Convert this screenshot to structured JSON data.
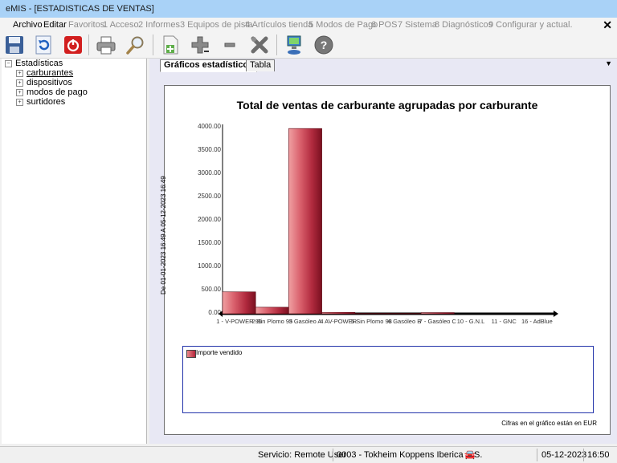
{
  "window": {
    "title": "eMIS - [ESTADISTICAS DE VENTAS]"
  },
  "menu": {
    "items": [
      "Archivo",
      "Editar",
      "Favoritos",
      "1 Acceso",
      "2 Informes",
      "3 Equipos de pista",
      "4 Artículos tienda",
      "5 Modos de Pago",
      "6 POS",
      "7 Sistema",
      "8 Diagnósticos",
      "9 Configurar y actual."
    ],
    "close": "✕"
  },
  "toolbar": {
    "icons": [
      "save-icon",
      "undo-icon",
      "power-icon",
      "print-icon",
      "search-icon",
      "new-document-icon",
      "add-icon",
      "remove-icon",
      "tools-icon",
      "network-computer-icon",
      "help-icon"
    ]
  },
  "tree": {
    "root": "Estadísticas",
    "items": [
      "carburantes",
      "dispositivos",
      "modos de pago",
      "surtidores"
    ]
  },
  "tabs": [
    "Gráficos estadísticos",
    "Tabla"
  ],
  "chart_data": {
    "type": "bar",
    "title": "Total de ventas de carburante agrupadas por carburante",
    "categories": [
      "1 - V-POWER 95",
      "2 - Sin Plomo 95",
      "3 - Gasóleo A",
      "4 - AV-POWER",
      "5 - Sin Plomo 98",
      "6 - Gasóleo B",
      "7 - Gasóleo C",
      "10 - G.N.L",
      "11 - GNC",
      "16 - AdBlue"
    ],
    "series": [
      {
        "name": "Importe vendido",
        "values": [
          470,
          140,
          3980,
          30,
          8,
          8,
          25,
          0,
          0,
          0
        ]
      }
    ],
    "ylim": [
      0,
      4000
    ],
    "yticks": [
      "4000.00",
      "3500.00",
      "3000.00",
      "2500.00",
      "2000.00",
      "1500.00",
      "1000.00",
      "500.00",
      "0.00"
    ],
    "xtick_labels": [
      "1 - V-POWER 95",
      "2 Sin Plomo 95",
      "3 Gasóleo A",
      "4 AV-POWER",
      "5 Sin Plomo 98",
      "6 Gasóleo B",
      "7 - Gasóleo C",
      "10 - G.N.L",
      "11 - GNC",
      "16 - AdBlue"
    ],
    "legend": "Importe vendido",
    "date_range": "De 01-01-2023 16:49 A 05-12-2023 16:49",
    "footnote": "Cifras en el gráfico están en EUR"
  },
  "status": {
    "service": "Servicio: Remote User",
    "company": "0003 - Tokheim Koppens Iberica S.S.",
    "date": "05-12-2023",
    "time": "16:50"
  }
}
